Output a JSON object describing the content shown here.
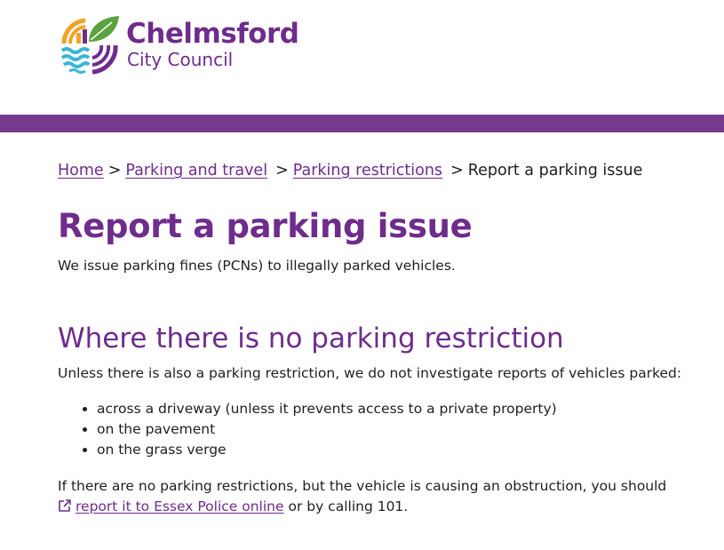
{
  "header": {
    "logo_name": "Chelmsford",
    "logo_sub": "City Council",
    "brand_color": "#6e2c8c",
    "bar_color": "#753a8b"
  },
  "breadcrumb": {
    "items": [
      {
        "label": "Home"
      },
      {
        "label": "Parking and travel"
      },
      {
        "label": "Parking restrictions"
      }
    ],
    "current": "Report a parking issue",
    "separator": ">"
  },
  "main": {
    "title": "Report a parking issue",
    "intro": "We issue parking fines (PCNs) to illegally parked vehicles.",
    "section": {
      "heading": "Where there is no parking restriction",
      "lead": "Unless there is also a parking restriction, we do not investigate reports of vehicles parked:",
      "bullets": [
        "across a driveway (unless it prevents access to a private property)",
        "on the pavement",
        "on the grass verge"
      ],
      "obstruction_text": "If there are no parking restrictions, but the vehicle is causing an obstruction, you should",
      "police_link_icon": "external-link-icon",
      "police_link": "report it to Essex Police online",
      "obstruction_tail": " or by calling 101."
    }
  }
}
